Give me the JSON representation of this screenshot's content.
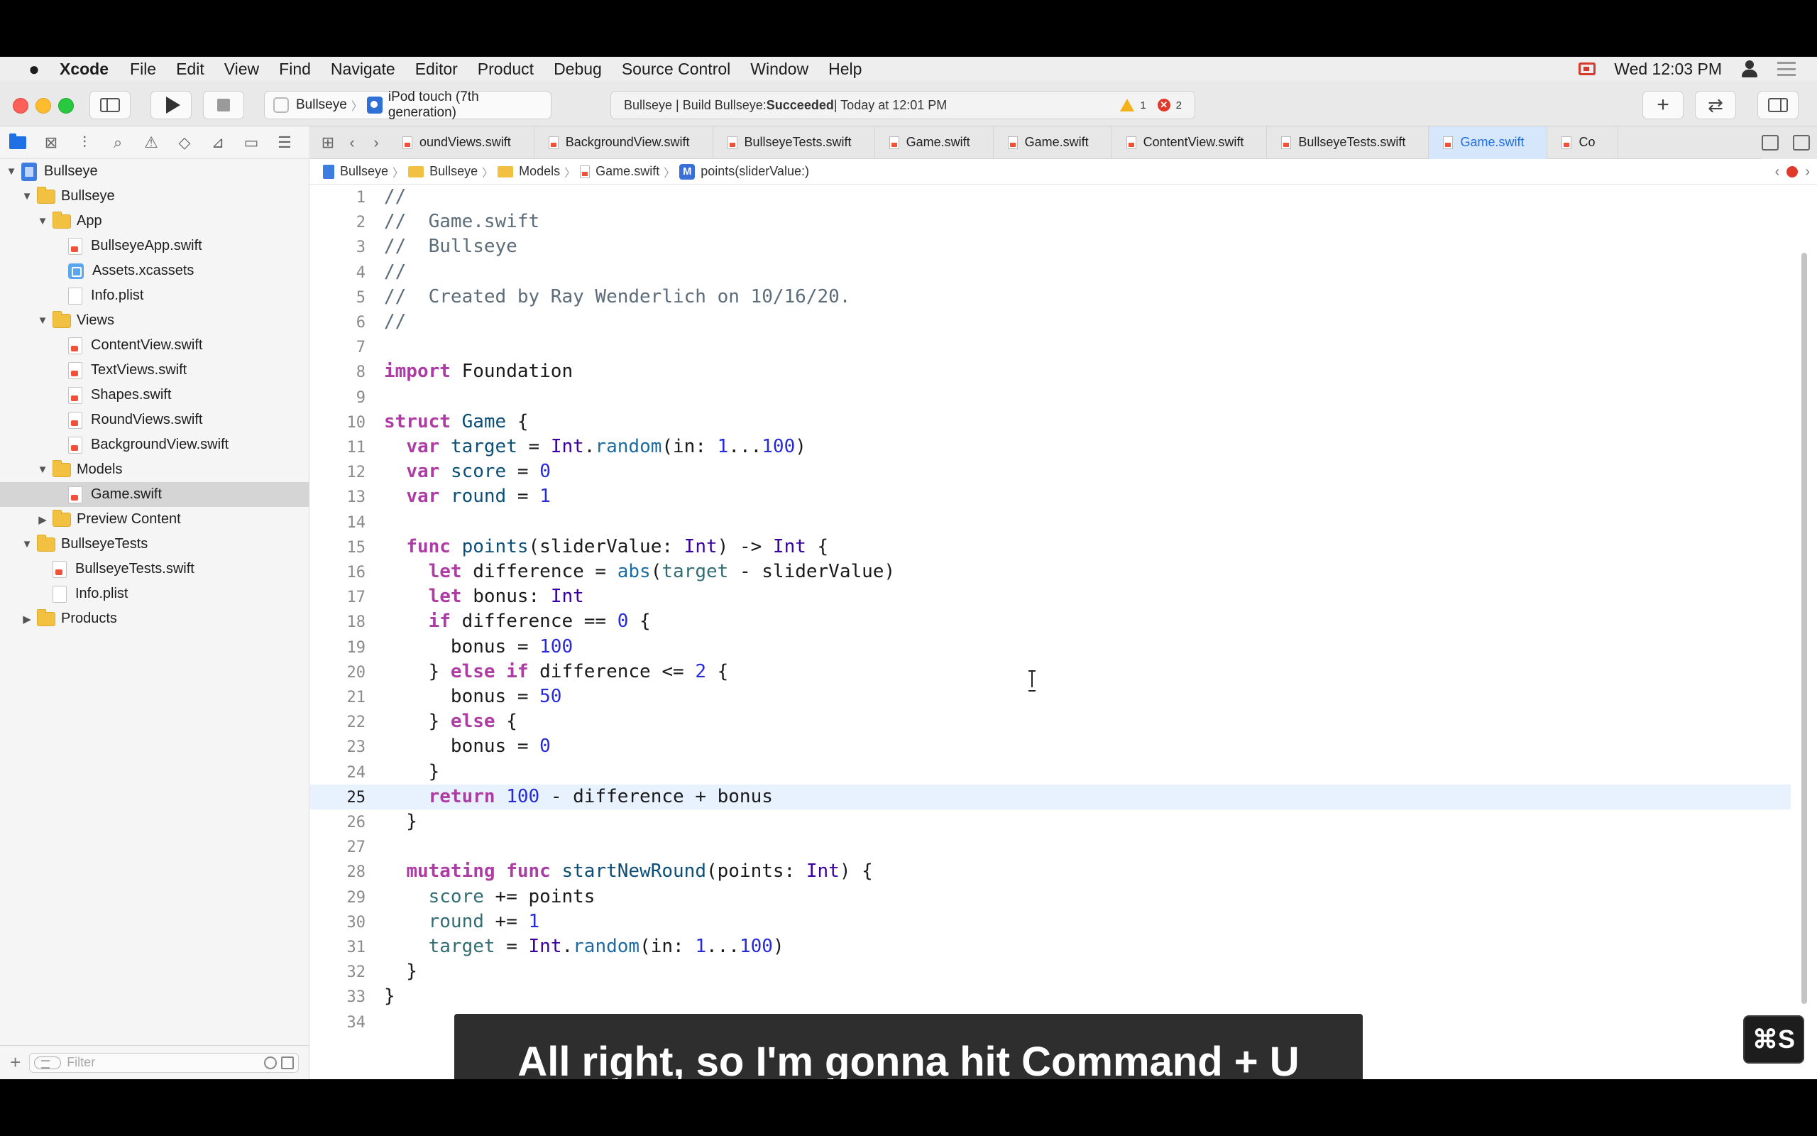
{
  "menubar": {
    "apple": "",
    "items": [
      "Xcode",
      "File",
      "Edit",
      "View",
      "Find",
      "Navigate",
      "Editor",
      "Product",
      "Debug",
      "Source Control",
      "Window",
      "Help"
    ],
    "clock": "Wed 12:03 PM"
  },
  "toolbar": {
    "scheme": "Bullseye",
    "device": "iPod touch (7th generation)",
    "activity_prefix": "Bullseye | Build Bullseye: ",
    "activity_status": "Succeeded",
    "activity_suffix": " | Today at 12:01 PM",
    "warning_count": "1",
    "error_count": "2",
    "add_label": "+",
    "swap_label": "⇄"
  },
  "navigator": {
    "tree": [
      {
        "label": "Bullseye",
        "kind": "project",
        "depth": 0,
        "disclosure": "▼"
      },
      {
        "label": "Bullseye",
        "kind": "folder",
        "depth": 1,
        "disclosure": "▼"
      },
      {
        "label": "App",
        "kind": "folder",
        "depth": 2,
        "disclosure": "▼"
      },
      {
        "label": "BullseyeApp.swift",
        "kind": "swift",
        "depth": 3
      },
      {
        "label": "Assets.xcassets",
        "kind": "assets",
        "depth": 3
      },
      {
        "label": "Info.plist",
        "kind": "plist",
        "depth": 3
      },
      {
        "label": "Views",
        "kind": "folder",
        "depth": 2,
        "disclosure": "▼"
      },
      {
        "label": "ContentView.swift",
        "kind": "swift",
        "depth": 3
      },
      {
        "label": "TextViews.swift",
        "kind": "swift",
        "depth": 3
      },
      {
        "label": "Shapes.swift",
        "kind": "swift",
        "depth": 3
      },
      {
        "label": "RoundViews.swift",
        "kind": "swift",
        "depth": 3
      },
      {
        "label": "BackgroundView.swift",
        "kind": "swift",
        "depth": 3
      },
      {
        "label": "Models",
        "kind": "folder",
        "depth": 2,
        "disclosure": "▼"
      },
      {
        "label": "Game.swift",
        "kind": "swift",
        "depth": 3,
        "selected": true
      },
      {
        "label": "Preview Content",
        "kind": "folder",
        "depth": 2,
        "disclosure": "▶"
      },
      {
        "label": "BullseyeTests",
        "kind": "folder",
        "depth": 1,
        "disclosure": "▼"
      },
      {
        "label": "BullseyeTests.swift",
        "kind": "swift",
        "depth": 2
      },
      {
        "label": "Info.plist",
        "kind": "plist",
        "depth": 2
      },
      {
        "label": "Products",
        "kind": "folder",
        "depth": 1,
        "disclosure": "▶"
      }
    ],
    "filter_placeholder": "Filter"
  },
  "tabs": [
    {
      "label": "oundViews.swift",
      "active": false
    },
    {
      "label": "BackgroundView.swift",
      "active": false
    },
    {
      "label": "BullseyeTests.swift",
      "active": false
    },
    {
      "label": "Game.swift",
      "active": false
    },
    {
      "label": "Game.swift",
      "active": false
    },
    {
      "label": "ContentView.swift",
      "active": false
    },
    {
      "label": "BullseyeTests.swift",
      "active": false
    },
    {
      "label": "Game.swift",
      "active": true
    },
    {
      "label": "Co",
      "active": false
    }
  ],
  "jumpbar": {
    "crumbs": [
      "Bullseye",
      "Bullseye",
      "Models",
      "Game.swift",
      "points(sliderValue:)"
    ],
    "method_badge": "M"
  },
  "editor": {
    "current_line": 25,
    "lines": [
      [
        [
          "cm",
          "//"
        ]
      ],
      [
        [
          "cm",
          "//  Game.swift"
        ]
      ],
      [
        [
          "cm",
          "//  Bullseye"
        ]
      ],
      [
        [
          "cm",
          "//"
        ]
      ],
      [
        [
          "cm",
          "//  Created by Ray Wenderlich on 10/16/20."
        ]
      ],
      [
        [
          "cm",
          "//"
        ]
      ],
      [],
      [
        [
          "kw",
          "import"
        ],
        [
          "pl",
          " Foundation"
        ]
      ],
      [],
      [
        [
          "kw",
          "struct"
        ],
        [
          "pl",
          " "
        ],
        [
          "decl",
          "Game"
        ],
        [
          "pl",
          " {"
        ]
      ],
      [
        [
          "pl",
          "  "
        ],
        [
          "kw",
          "var"
        ],
        [
          "pl",
          " "
        ],
        [
          "decl",
          "target"
        ],
        [
          "pl",
          " = "
        ],
        [
          "type",
          "Int"
        ],
        [
          "pl",
          "."
        ],
        [
          "fn",
          "random"
        ],
        [
          "pl",
          "(in: "
        ],
        [
          "num",
          "1"
        ],
        [
          "pl",
          "..."
        ],
        [
          "num",
          "100"
        ],
        [
          "pl",
          ")"
        ]
      ],
      [
        [
          "pl",
          "  "
        ],
        [
          "kw",
          "var"
        ],
        [
          "pl",
          " "
        ],
        [
          "decl",
          "score"
        ],
        [
          "pl",
          " = "
        ],
        [
          "num",
          "0"
        ]
      ],
      [
        [
          "pl",
          "  "
        ],
        [
          "kw",
          "var"
        ],
        [
          "pl",
          " "
        ],
        [
          "decl",
          "round"
        ],
        [
          "pl",
          " = "
        ],
        [
          "num",
          "1"
        ]
      ],
      [],
      [
        [
          "pl",
          "  "
        ],
        [
          "kw",
          "func"
        ],
        [
          "pl",
          " "
        ],
        [
          "decl",
          "points"
        ],
        [
          "pl",
          "(sliderValue: "
        ],
        [
          "type",
          "Int"
        ],
        [
          "pl",
          ") -> "
        ],
        [
          "type",
          "Int"
        ],
        [
          "pl",
          " {"
        ]
      ],
      [
        [
          "pl",
          "    "
        ],
        [
          "kw",
          "let"
        ],
        [
          "pl",
          " difference = "
        ],
        [
          "fn",
          "abs"
        ],
        [
          "pl",
          "("
        ],
        [
          "ref",
          "target"
        ],
        [
          "pl",
          " - sliderValue)"
        ]
      ],
      [
        [
          "pl",
          "    "
        ],
        [
          "kw",
          "let"
        ],
        [
          "pl",
          " bonus: "
        ],
        [
          "type",
          "Int"
        ]
      ],
      [
        [
          "pl",
          "    "
        ],
        [
          "kw",
          "if"
        ],
        [
          "pl",
          " difference == "
        ],
        [
          "num",
          "0"
        ],
        [
          "pl",
          " {"
        ]
      ],
      [
        [
          "pl",
          "      bonus = "
        ],
        [
          "num",
          "100"
        ]
      ],
      [
        [
          "pl",
          "    } "
        ],
        [
          "kw",
          "else if"
        ],
        [
          "pl",
          " difference <= "
        ],
        [
          "num",
          "2"
        ],
        [
          "pl",
          " {"
        ]
      ],
      [
        [
          "pl",
          "      bonus = "
        ],
        [
          "num",
          "50"
        ]
      ],
      [
        [
          "pl",
          "    } "
        ],
        [
          "kw",
          "else"
        ],
        [
          "pl",
          " {"
        ]
      ],
      [
        [
          "pl",
          "      bonus = "
        ],
        [
          "num",
          "0"
        ]
      ],
      [
        [
          "pl",
          "    }"
        ]
      ],
      [
        [
          "pl",
          "    "
        ],
        [
          "kw",
          "return"
        ],
        [
          "pl",
          " "
        ],
        [
          "num",
          "100"
        ],
        [
          "pl",
          " - difference + bonus"
        ]
      ],
      [
        [
          "pl",
          "  }"
        ]
      ],
      [],
      [
        [
          "pl",
          "  "
        ],
        [
          "kw",
          "mutating"
        ],
        [
          "pl",
          " "
        ],
        [
          "kw",
          "func"
        ],
        [
          "pl",
          " "
        ],
        [
          "decl",
          "startNewRound"
        ],
        [
          "pl",
          "(points: "
        ],
        [
          "type",
          "Int"
        ],
        [
          "pl",
          ") {"
        ]
      ],
      [
        [
          "pl",
          "    "
        ],
        [
          "ref",
          "score"
        ],
        [
          "pl",
          " += points"
        ]
      ],
      [
        [
          "pl",
          "    "
        ],
        [
          "ref",
          "round"
        ],
        [
          "pl",
          " += "
        ],
        [
          "num",
          "1"
        ]
      ],
      [
        [
          "pl",
          "    "
        ],
        [
          "ref",
          "target"
        ],
        [
          "pl",
          " = "
        ],
        [
          "type",
          "Int"
        ],
        [
          "pl",
          "."
        ],
        [
          "fn",
          "random"
        ],
        [
          "pl",
          "(in: "
        ],
        [
          "num",
          "1"
        ],
        [
          "pl",
          "..."
        ],
        [
          "num",
          "100"
        ],
        [
          "pl",
          ")"
        ]
      ],
      [
        [
          "pl",
          "  }"
        ]
      ],
      [
        [
          "pl",
          "}"
        ]
      ],
      []
    ]
  },
  "caption": "All right, so I'm gonna hit Command + U",
  "keystroke": "⌘S",
  "colors": {
    "accent": "#1f6fe5",
    "keyword": "#ad3da4",
    "comment": "#5d6c79",
    "number": "#272ad8",
    "type": "#3900a0"
  }
}
